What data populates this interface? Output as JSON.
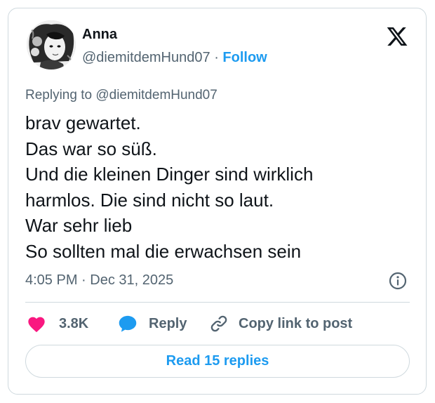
{
  "author": {
    "name": "Anna",
    "handle": "@diemitdemHund07",
    "separator": "·",
    "follow_label": "Follow"
  },
  "replying_to": "Replying to @diemitdemHund07",
  "body_lines": [
    "brav gewartet.",
    "Das war so süß.",
    "Und die kleinen Dinger sind wirklich",
    "harmlos. Die sind nicht so laut.",
    "War sehr lieb",
    "So sollten mal die erwachsen sein"
  ],
  "timestamp": "4:05 PM · Dec 31, 2025",
  "actions": {
    "like_count": "3.8K",
    "reply_label": "Reply",
    "copy_link_label": "Copy link to post"
  },
  "read_replies_label": "Read 15 replies",
  "icons": {
    "brand": "x-logo-icon",
    "info": "info-icon",
    "like": "heart-icon",
    "reply": "speech-bubble-icon",
    "copy": "link-icon"
  },
  "colors": {
    "accent": "#1d9bf0",
    "like": "#f91880",
    "text": "#0f1419",
    "muted": "#536471",
    "border": "#cfd9de"
  }
}
